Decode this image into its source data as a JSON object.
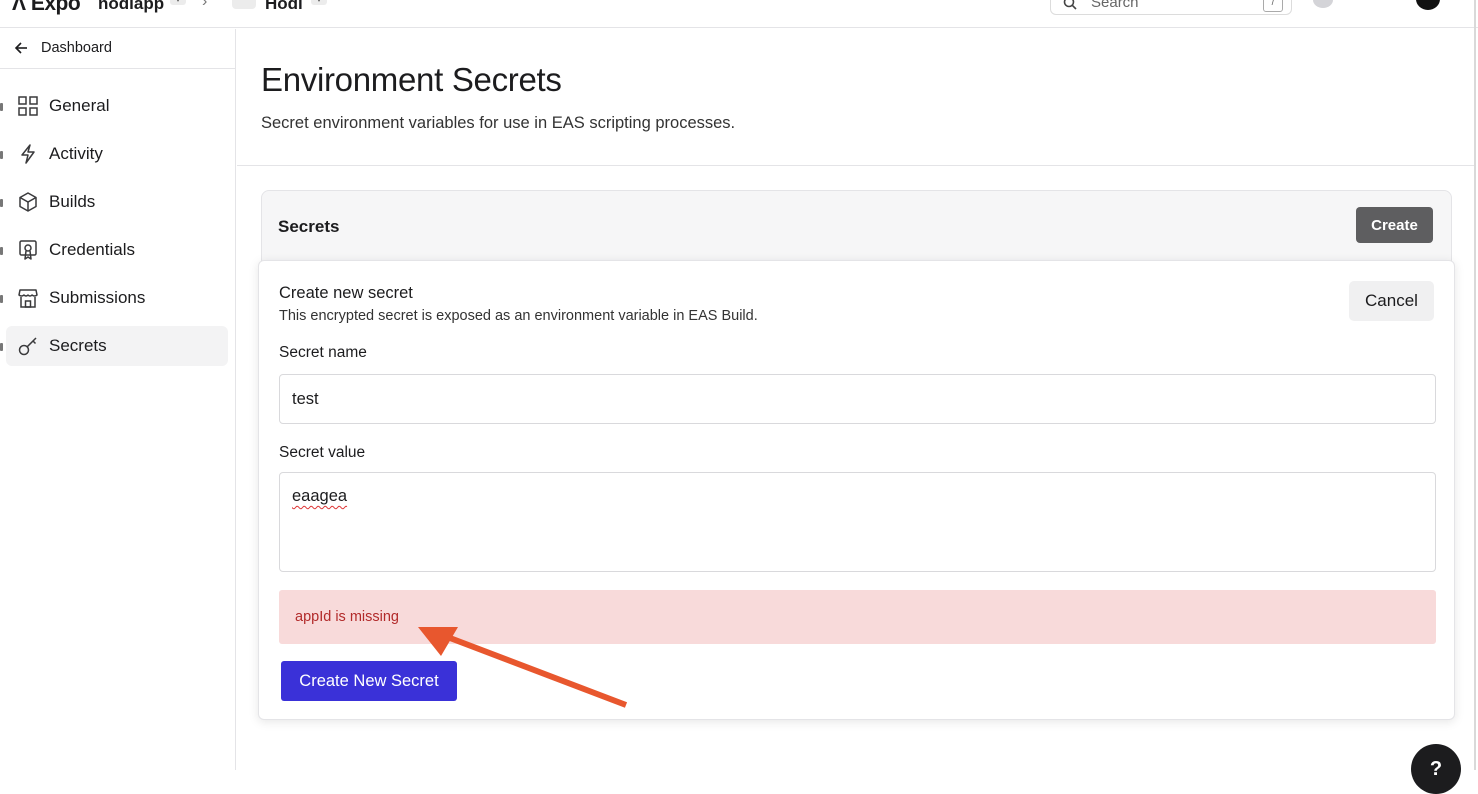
{
  "topbar": {
    "brand": "Expo",
    "account": "nodiapp",
    "breadcrumb_sep": "›",
    "project": "Hodl",
    "caret": "▾",
    "search_placeholder": "Search",
    "search_shortcut": "/",
    "more": "···"
  },
  "sidebar": {
    "back_label": "Dashboard",
    "items": [
      {
        "label": "General",
        "icon": "grid-icon"
      },
      {
        "label": "Activity",
        "icon": "lightning-icon"
      },
      {
        "label": "Builds",
        "icon": "cube-icon"
      },
      {
        "label": "Credentials",
        "icon": "certificate-icon"
      },
      {
        "label": "Submissions",
        "icon": "storefront-icon"
      },
      {
        "label": "Secrets",
        "icon": "key-icon",
        "active": true
      }
    ]
  },
  "page": {
    "title": "Environment Secrets",
    "subtitle": "Secret environment variables for use in EAS scripting processes."
  },
  "secrets_card": {
    "heading": "Secrets",
    "create_label": "Create"
  },
  "form": {
    "title": "Create new secret",
    "description": "This encrypted secret is exposed as an environment variable in EAS Build.",
    "cancel_label": "Cancel",
    "name_label": "Secret name",
    "name_value": "test",
    "value_label": "Secret value",
    "value_value": "eaagea",
    "error_message": "appId is missing",
    "submit_label": "Create New Secret"
  },
  "help_label": "?",
  "colors": {
    "primary_button": "#3a31d8",
    "error_bg": "#f8dada",
    "error_text": "#b22a2a",
    "annotation_arrow": "#e8572e",
    "create_button": "#5e5e60"
  }
}
